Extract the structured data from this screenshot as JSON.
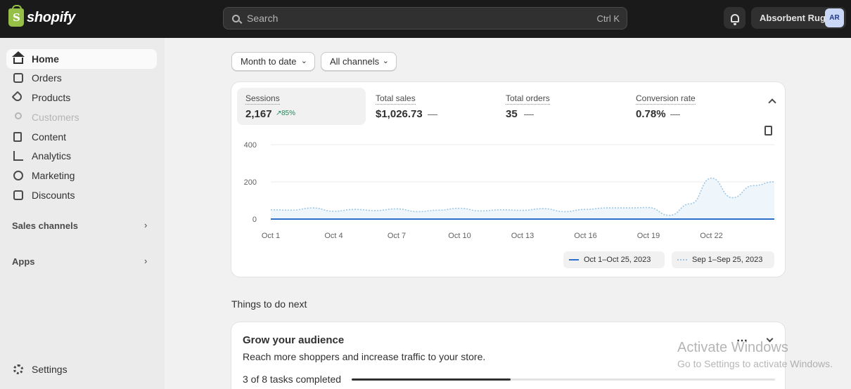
{
  "topbar": {
    "logo_text": "shopify",
    "search_placeholder": "Search",
    "search_shortcut": "Ctrl K",
    "store_name": "Absorbent Rug",
    "avatar_initials": "AR"
  },
  "sidebar": {
    "items": [
      {
        "label": "Home",
        "icon": "home-icon"
      },
      {
        "label": "Orders",
        "icon": "orders-icon"
      },
      {
        "label": "Products",
        "icon": "products-icon"
      },
      {
        "label": "Customers",
        "icon": "customers-icon"
      },
      {
        "label": "Content",
        "icon": "content-icon"
      },
      {
        "label": "Analytics",
        "icon": "analytics-icon"
      },
      {
        "label": "Marketing",
        "icon": "marketing-icon"
      },
      {
        "label": "Discounts",
        "icon": "discounts-icon"
      }
    ],
    "sales_channels_label": "Sales channels",
    "apps_label": "Apps",
    "settings_label": "Settings"
  },
  "filters": {
    "date_range": "Month to date",
    "channels": "All channels"
  },
  "metrics": [
    {
      "label": "Sessions",
      "value": "2,167",
      "trend": "85%"
    },
    {
      "label": "Total sales",
      "value": "$1,026.73",
      "trend": "—"
    },
    {
      "label": "Total orders",
      "value": "35",
      "trend": "—"
    },
    {
      "label": "Conversion rate",
      "value": "0.78%",
      "trend": "—"
    }
  ],
  "chart_data": {
    "type": "line",
    "x": [
      "Oct 1",
      "Oct 2",
      "Oct 3",
      "Oct 4",
      "Oct 5",
      "Oct 6",
      "Oct 7",
      "Oct 8",
      "Oct 9",
      "Oct 10",
      "Oct 11",
      "Oct 12",
      "Oct 13",
      "Oct 14",
      "Oct 15",
      "Oct 16",
      "Oct 17",
      "Oct 18",
      "Oct 19",
      "Oct 20",
      "Oct 21",
      "Oct 22",
      "Oct 23",
      "Oct 24",
      "Oct 25"
    ],
    "tick_labels": [
      "Oct 1",
      "Oct 4",
      "Oct 7",
      "Oct 10",
      "Oct 13",
      "Oct 16",
      "Oct 19",
      "Oct 22"
    ],
    "y_ticks": [
      "400",
      "200",
      "0"
    ],
    "ylim": [
      0,
      400
    ],
    "series": [
      {
        "name": "Oct 1–Oct 25, 2023",
        "color": "#2c6ecb",
        "values": [
          0,
          0,
          0,
          0,
          0,
          0,
          0,
          0,
          0,
          0,
          0,
          0,
          0,
          0,
          0,
          0,
          0,
          0,
          0,
          0,
          0,
          0,
          0,
          0,
          0
        ]
      },
      {
        "name": "Sep 1–Sep 25, 2023",
        "color": "#9ec7e6",
        "values": [
          50,
          48,
          60,
          42,
          52,
          46,
          55,
          40,
          48,
          58,
          44,
          50,
          47,
          56,
          40,
          52,
          60,
          60,
          62,
          20,
          82,
          220,
          115,
          180,
          200
        ]
      }
    ],
    "grid": true
  },
  "things_to_do": {
    "title": "Things to do next",
    "card_title": "Grow your audience",
    "card_desc": "Reach more shoppers and increase traffic to your store.",
    "progress_label": "3 of 8 tasks completed",
    "progress_fraction": 0.375
  },
  "watermark": {
    "line1": "Activate Windows",
    "line2": "Go to Settings to activate Windows."
  }
}
